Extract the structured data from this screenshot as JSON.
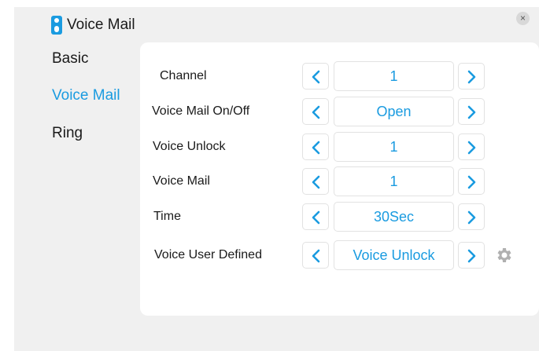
{
  "window": {
    "title": "Voice Mail",
    "close_label": "×"
  },
  "sidebar": {
    "items": [
      {
        "label": "Basic",
        "active": false
      },
      {
        "label": "Voice Mail",
        "active": true
      },
      {
        "label": "Ring",
        "active": false
      }
    ]
  },
  "settings": [
    {
      "label": "Channel",
      "value": "1"
    },
    {
      "label": "Voice Mail On/Off",
      "value": "Open"
    },
    {
      "label": "Voice Unlock",
      "value": "1"
    },
    {
      "label": "Voice Mail",
      "value": "1"
    },
    {
      "label": "Time",
      "value": "30Sec"
    },
    {
      "label": "Voice User Defined",
      "value": "Voice Unlock"
    }
  ],
  "icons": {
    "title": "voice-mail-icon",
    "prev": "chevron-left-icon",
    "next": "chevron-right-icon",
    "settings": "gear-icon",
    "close": "close-icon"
  },
  "colors": {
    "accent": "#1a9be0",
    "text": "#1a1a1a",
    "background": "#f0f0f0",
    "panel": "#ffffff",
    "gear": "#b0b0b0"
  }
}
